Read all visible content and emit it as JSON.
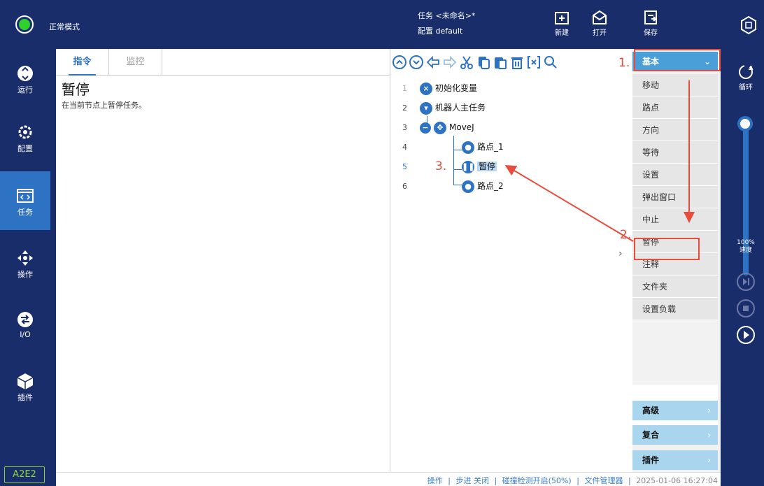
{
  "topbar": {
    "mode_label": "正常模式",
    "task_line": "任务 <未命名>*",
    "config_line": "配置 default",
    "new_label": "新建",
    "open_label": "打开",
    "save_label": "保存"
  },
  "nav": {
    "items": [
      {
        "label": "运行",
        "icon": "run-icon"
      },
      {
        "label": "配置",
        "icon": "gear-icon"
      },
      {
        "label": "任务",
        "icon": "code-icon"
      },
      {
        "label": "操作",
        "icon": "move-icon"
      },
      {
        "label": "I/O",
        "icon": "io-icon"
      },
      {
        "label": "插件",
        "icon": "plugin-icon"
      }
    ],
    "version": "A2E2"
  },
  "left_panel": {
    "tabs": [
      "指令",
      "监控"
    ],
    "command_title": "暂停",
    "command_desc": "在当前节点上暂停任务。"
  },
  "tree": {
    "line_numbers": [
      "1",
      "2",
      "3",
      "4",
      "5",
      "6"
    ],
    "nodes": [
      "初始化变量",
      "机器人主任务",
      "MoveJ",
      "路点_1",
      "暂停",
      "路点_2"
    ]
  },
  "right_panel": {
    "category": "基本",
    "commands": [
      "移动",
      "路点",
      "方向",
      "等待",
      "设置",
      "弹出窗口",
      "中止",
      "暂停",
      "注释",
      "文件夹",
      "设置负载"
    ],
    "bottom_categories": [
      "高级",
      "复合",
      "插件"
    ]
  },
  "rightbar": {
    "loop_label": "循环",
    "speed_value": "100%",
    "speed_label": "速度"
  },
  "statusbar": {
    "operate": "操作",
    "step": "步进 关闭",
    "collision": "碰撞检测开启(50%)",
    "file_manager": "文件管理器",
    "datetime": "2025-01-06 16:27:04"
  },
  "annotations": [
    "1.",
    "2.",
    "3."
  ],
  "colors": {
    "accent": "#2e72c4",
    "nav_bg": "#1a2d6b",
    "annotation": "#e84c3d"
  }
}
